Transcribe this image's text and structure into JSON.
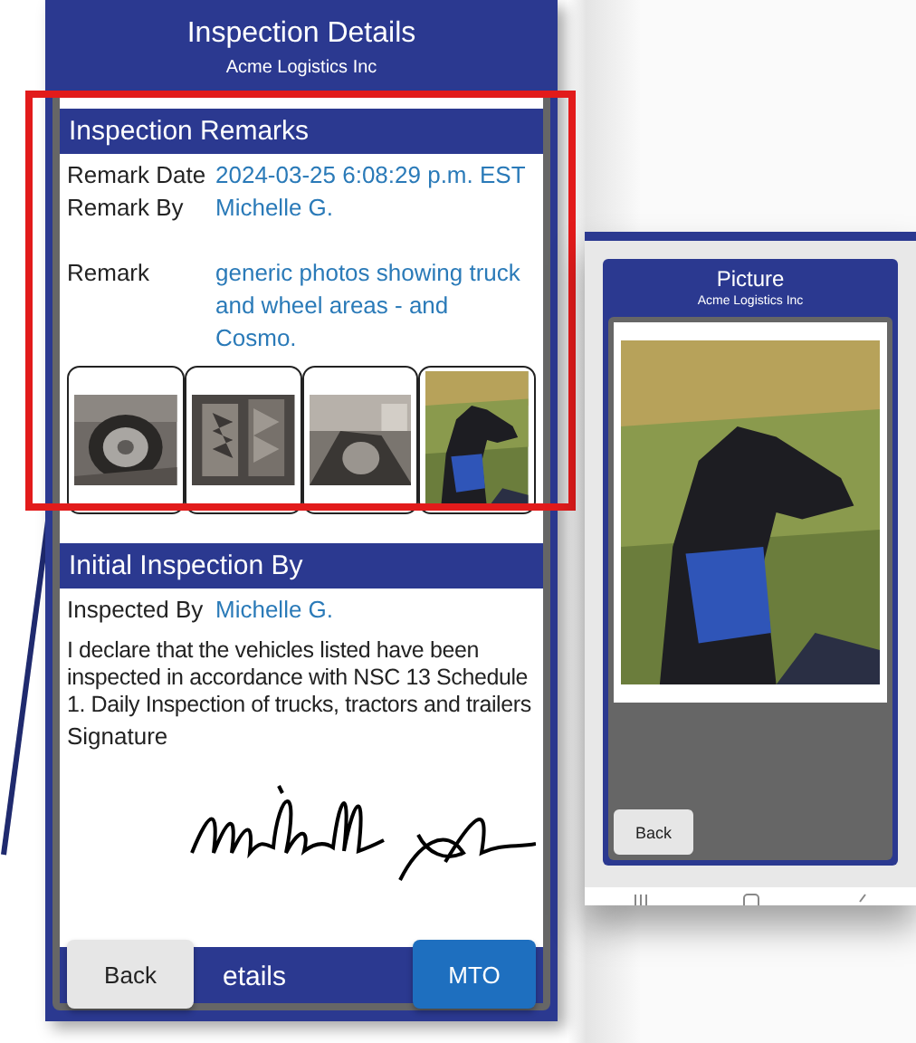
{
  "left_screen": {
    "header": {
      "title": "Inspection Details",
      "subtitle": "Acme Logistics Inc"
    },
    "remarks_section": {
      "title": "Inspection Remarks",
      "fields": [
        {
          "label": "Remark Date",
          "value": "2024-03-25 6:08:29 p.m. EST"
        },
        {
          "label": "Remark By",
          "value": "Michelle G."
        },
        {
          "label": "Remark",
          "value": "generic photos showing truck and wheel areas - and Cosmo."
        }
      ],
      "photos": [
        {
          "kind": "picture"
        },
        {
          "kind": "picture"
        },
        {
          "kind": "picture"
        },
        {
          "kind": "picture"
        }
      ]
    },
    "inspection_section": {
      "title": "Initial Inspection By",
      "fields": [
        {
          "label": "Inspected By",
          "value": "Michelle G."
        }
      ],
      "declaration": "I declare that the vehicles listed have been inspected in accordance with NSC 13 Schedule 1. Daily Inspection of trucks, tractors and trailers",
      "signature_label": "Signature"
    },
    "next_section": {
      "title": "etails"
    },
    "buttons": [
      "Back",
      "MTO"
    ]
  },
  "right_screen": {
    "header": {
      "title": "Picture",
      "subtitle": "Acme Logistics Inc"
    },
    "photo": {
      "kind": "picture"
    },
    "buttons": [
      "Back"
    ]
  }
}
